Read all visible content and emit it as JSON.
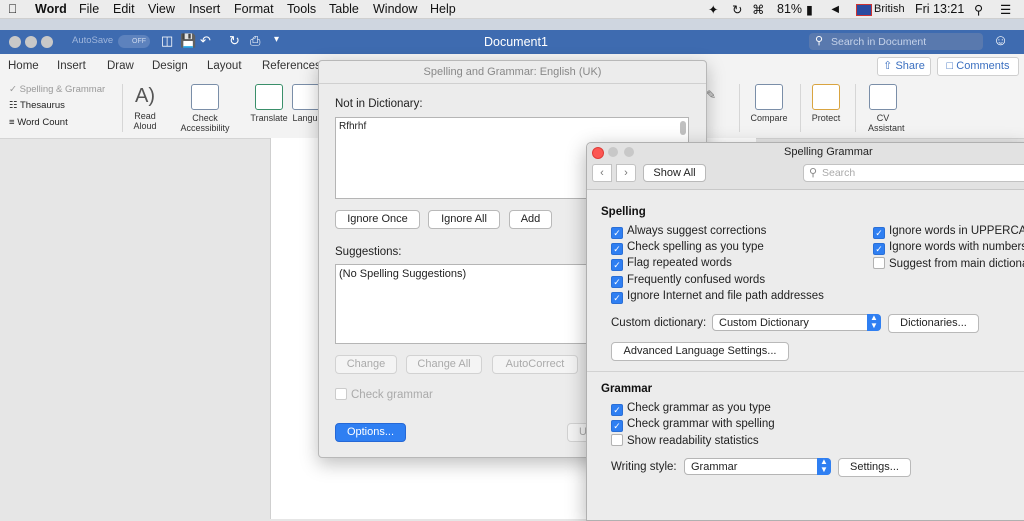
{
  "menubar": {
    "app": "Word",
    "items": [
      "File",
      "Edit",
      "View",
      "Insert",
      "Format",
      "Tools",
      "Table",
      "Window",
      "Help"
    ],
    "battery": "81%",
    "input_source": "British",
    "clock": "Fri 13:21"
  },
  "word_window": {
    "autosave_label": "AutoSave",
    "autosave_state": "OFF",
    "title": "Document1",
    "search_placeholder": "Search in Document",
    "tabs": [
      "Home",
      "Insert",
      "Draw",
      "Design",
      "Layout",
      "References"
    ],
    "share_label": "Share",
    "comments_label": "Comments",
    "proofing": [
      "Spelling & Grammar",
      "Thesaurus",
      "Word Count"
    ],
    "ribbon_buttons": {
      "read_aloud": "Read Aloud",
      "check_accessibility": "Check Accessibility",
      "translate": "Translate",
      "language": "Langu",
      "compare": "Compare",
      "protect": "Protect",
      "cv_assistant": "CV Assistant"
    }
  },
  "spelling_dialog": {
    "title": "Spelling and Grammar: English (UK)",
    "not_in_dictionary_label": "Not in Dictionary:",
    "misspelled_word": "Rfhrhf",
    "ignore_once": "Ignore Once",
    "ignore_all": "Ignore All",
    "add": "Add",
    "suggestions_label": "Suggestions:",
    "suggestion_text": "(No Spelling Suggestions)",
    "change": "Change",
    "change_all": "Change All",
    "autocorrect": "AutoCorrect",
    "check_grammar": "Check grammar",
    "options": "Options...",
    "partial_button": "U"
  },
  "preferences": {
    "title": "Spelling  Grammar",
    "show_all": "Show All",
    "search_placeholder": "Search",
    "spelling_header": "Spelling",
    "spelling_left": [
      {
        "label": "Always suggest corrections",
        "checked": true
      },
      {
        "label": "Check spelling as you type",
        "checked": true
      },
      {
        "label": "Flag repeated words",
        "checked": true
      },
      {
        "label": "Frequently confused words",
        "checked": true
      },
      {
        "label": "Ignore Internet and file path addresses",
        "checked": true
      }
    ],
    "spelling_right": [
      {
        "label": "Ignore words in UPPERCASE",
        "checked": true
      },
      {
        "label": "Ignore words with numbers",
        "checked": true
      },
      {
        "label": "Suggest from main dictionary",
        "checked": false
      }
    ],
    "custom_dictionary_label": "Custom dictionary:",
    "custom_dictionary_value": "Custom Dictionary",
    "dictionaries_button": "Dictionaries...",
    "advanced_button": "Advanced Language Settings...",
    "grammar_header": "Grammar",
    "grammar_options": [
      {
        "label": "Check grammar as you type",
        "checked": true
      },
      {
        "label": "Check grammar with spelling",
        "checked": true
      },
      {
        "label": "Show readability statistics",
        "checked": false
      }
    ],
    "writing_style_label": "Writing style:",
    "writing_style_value": "Grammar",
    "settings_button": "Settings..."
  }
}
